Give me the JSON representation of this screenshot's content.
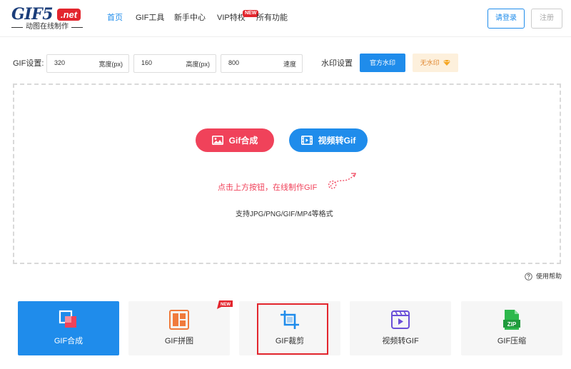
{
  "header": {
    "logo_main": "GIF5",
    "logo_net": ".net",
    "logo_sub": "动图在线制作",
    "nav": [
      {
        "label": "首页"
      },
      {
        "label": "GIF工具"
      },
      {
        "label": "新手中心"
      },
      {
        "label": "VIP特权"
      },
      {
        "label": "所有功能"
      }
    ],
    "nav_badge": "NEW",
    "login": "请登录",
    "register": "注册"
  },
  "settings": {
    "label": "GIF设置:",
    "width": {
      "value": "320",
      "unit": "宽度(px)"
    },
    "height": {
      "value": "160",
      "unit": "高度(px)"
    },
    "speed": {
      "value": "800",
      "unit": "速度"
    },
    "watermark_label": "水印设置",
    "official_wm": "官方水印",
    "no_wm": "无水印"
  },
  "upload": {
    "gif_button": "Gif合成",
    "video_button": "视频转Gif",
    "hint": "点击上方按钮，在线制作GIF",
    "formats": "支持JPG/PNG/GIF/MP4等格式"
  },
  "help": "使用帮助",
  "cards": [
    {
      "label": "GIF合成"
    },
    {
      "label": "GIF拼图",
      "badge": "NEW"
    },
    {
      "label": "GIF裁剪"
    },
    {
      "label": "视频转GIF"
    },
    {
      "label": "GIF压缩",
      "icon_text": "ZIP"
    }
  ],
  "colors": {
    "accent": "#1f8ceb",
    "red": "#f0425a",
    "brand_red": "#e3262e",
    "gold": "#e0862e"
  }
}
